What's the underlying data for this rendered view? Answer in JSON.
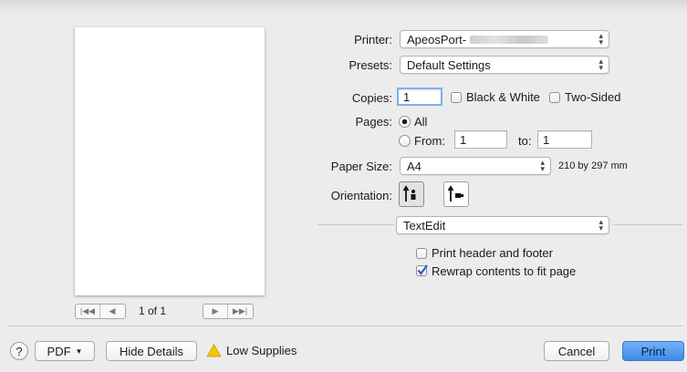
{
  "preview": {
    "page_counter": "1 of 1"
  },
  "printer": {
    "label": "Printer:",
    "value": "ApeosPort-"
  },
  "presets": {
    "label": "Presets:",
    "value": "Default Settings"
  },
  "copies": {
    "label": "Copies:",
    "value": "1",
    "black_white_label": "Black & White",
    "two_sided_label": "Two-Sided"
  },
  "pages": {
    "label": "Pages:",
    "all_label": "All",
    "from_label": "From:",
    "from_value": "1",
    "to_label": "to:",
    "to_value": "1"
  },
  "paper_size": {
    "label": "Paper Size:",
    "value": "A4",
    "dimensions": "210 by 297 mm"
  },
  "orientation": {
    "label": "Orientation:"
  },
  "app_options": {
    "section": "TextEdit",
    "header_footer_label": "Print header and footer",
    "header_footer_checked": false,
    "rewrap_label": "Rewrap contents to fit page",
    "rewrap_checked": true
  },
  "bottom": {
    "help": "?",
    "pdf_label": "PDF",
    "hide_details_label": "Hide Details",
    "low_supplies_label": "Low Supplies",
    "cancel_label": "Cancel",
    "print_label": "Print"
  },
  "colors": {
    "accent": "#3e8ae9",
    "warning": "#f5c400",
    "checkmark": "#2b5fb8"
  }
}
